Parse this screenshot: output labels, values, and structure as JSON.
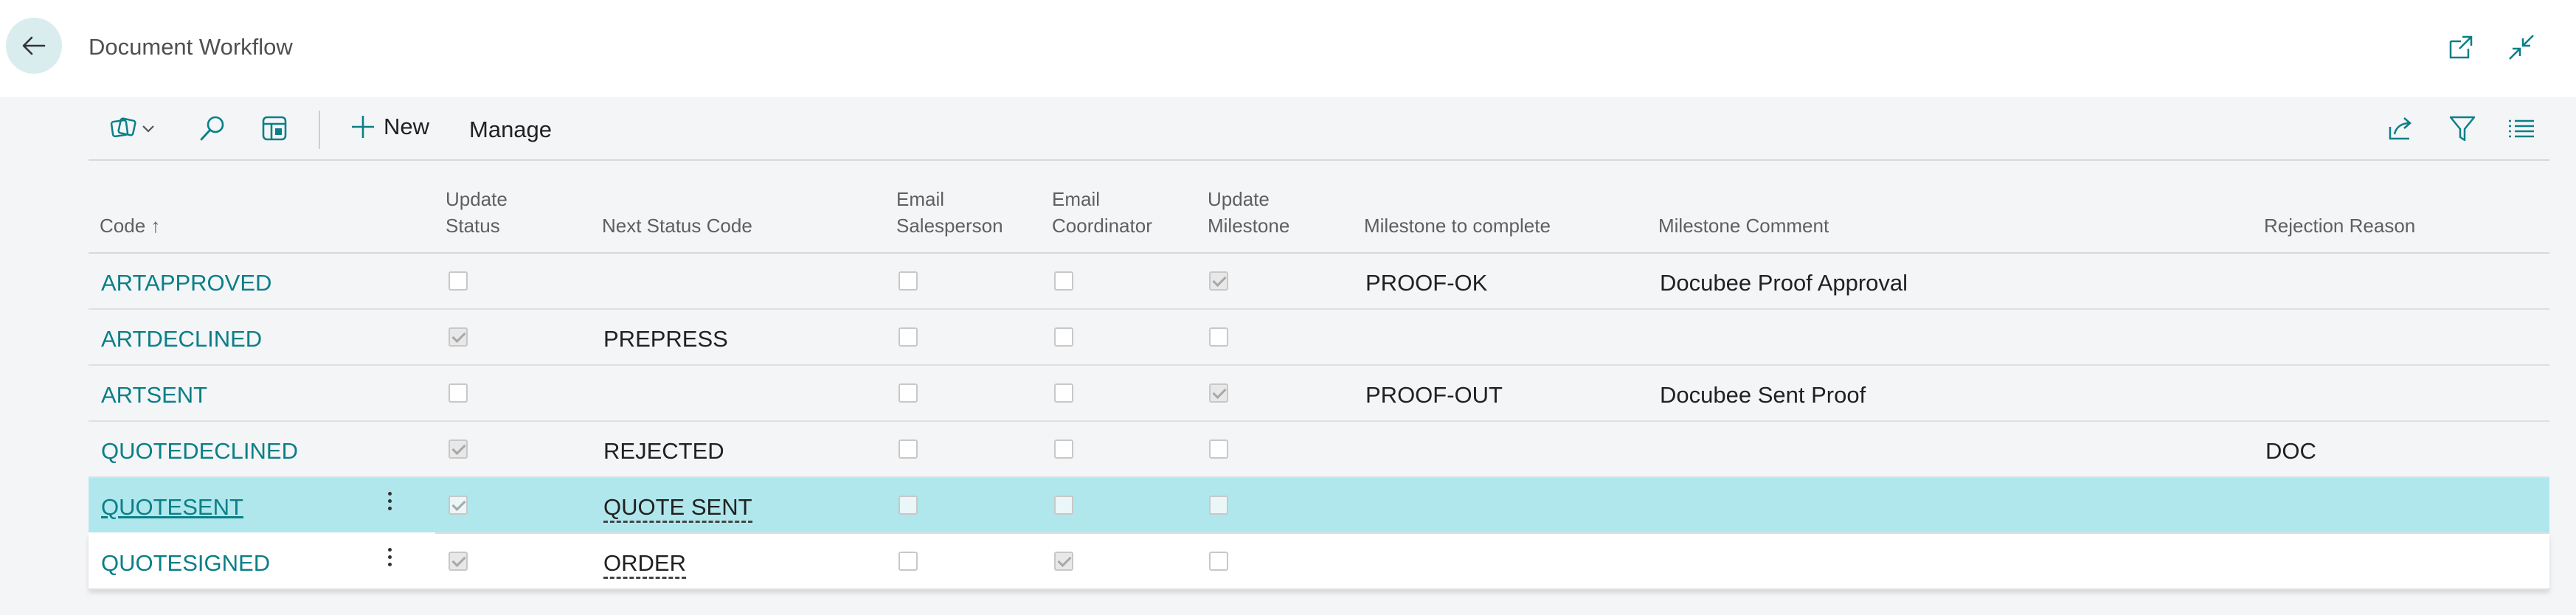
{
  "header": {
    "title": "Document Workflow",
    "back_icon": "arrow-left-icon",
    "open_new_icon": "open-in-new-window-icon",
    "collapse_icon": "collapse-icon"
  },
  "toolbar": {
    "new_label": "New",
    "manage_label": "Manage"
  },
  "columns": {
    "code": "Code ↑",
    "update_status_1": "Update",
    "update_status_2": "Status",
    "next_status": "Next Status Code",
    "email_salesperson_1": "Email",
    "email_salesperson_2": "Salesperson",
    "email_coordinator_1": "Email",
    "email_coordinator_2": "Coordinator",
    "update_milestone_1": "Update",
    "update_milestone_2": "Milestone",
    "milestone_to_complete": "Milestone to complete",
    "milestone_comment": "Milestone Comment",
    "rejection_reason": "Rejection Reason"
  },
  "rows": [
    {
      "code": "ARTAPPROVED",
      "update_status": false,
      "next_status": "",
      "email_salesperson": false,
      "email_coordinator": false,
      "update_milestone": true,
      "milestone": "PROOF-OK",
      "comment": "Docubee Proof Approval",
      "rejection": ""
    },
    {
      "code": "ARTDECLINED",
      "update_status": true,
      "next_status": "PREPRESS",
      "email_salesperson": false,
      "email_coordinator": false,
      "update_milestone": false,
      "milestone": "",
      "comment": "",
      "rejection": ""
    },
    {
      "code": "ARTSENT",
      "update_status": false,
      "next_status": "",
      "email_salesperson": false,
      "email_coordinator": false,
      "update_milestone": true,
      "milestone": "PROOF-OUT",
      "comment": "Docubee Sent Proof",
      "rejection": ""
    },
    {
      "code": "QUOTEDECLINED",
      "update_status": true,
      "next_status": "REJECTED",
      "email_salesperson": false,
      "email_coordinator": false,
      "update_milestone": false,
      "milestone": "",
      "comment": "",
      "rejection": "DOC"
    },
    {
      "code": "QUOTESENT",
      "update_status": true,
      "next_status": "QUOTE SENT",
      "email_salesperson": false,
      "email_coordinator": false,
      "update_milestone": false,
      "milestone": "",
      "comment": "",
      "rejection": ""
    },
    {
      "code": "QUOTESIGNED",
      "update_status": true,
      "next_status": "ORDER",
      "email_salesperson": false,
      "email_coordinator": true,
      "update_milestone": false,
      "milestone": "",
      "comment": "",
      "rejection": ""
    }
  ]
}
